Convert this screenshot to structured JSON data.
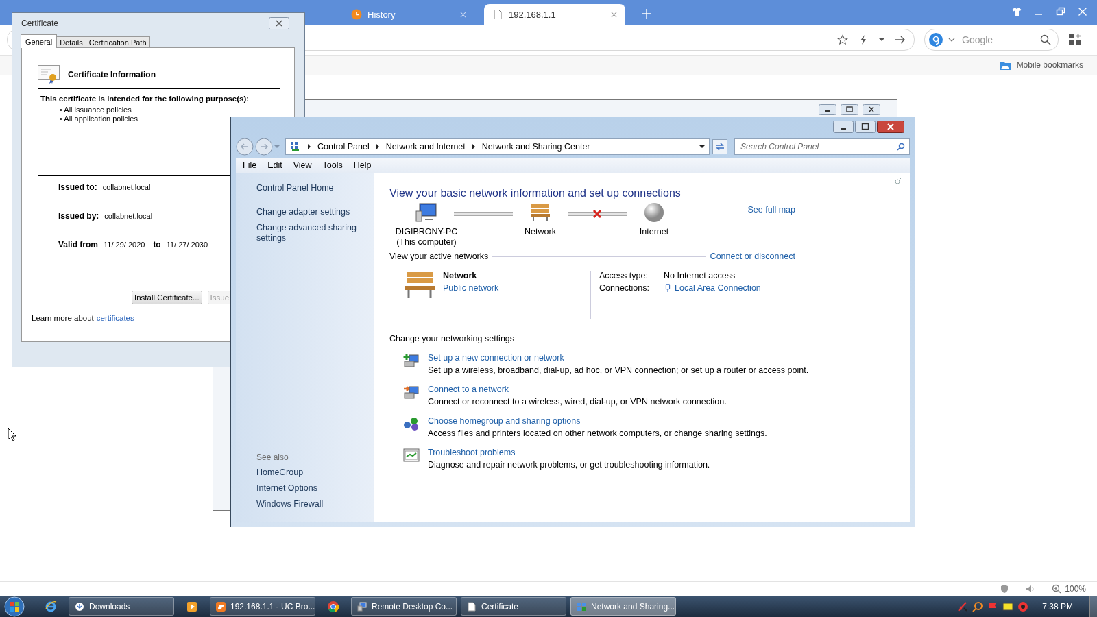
{
  "browser": {
    "tabs": [
      {
        "label": "History",
        "kind": "clock",
        "selected": false
      },
      {
        "label": "192.168.1.1",
        "kind": "page",
        "selected": true
      }
    ],
    "search_placeholder": "Google",
    "bookmark": "Mobile bookmarks",
    "zoom": "100%"
  },
  "certificate_dialog": {
    "title": "Certificate",
    "tabs": [
      {
        "label": "General",
        "selected": true
      },
      {
        "label": "Details",
        "selected": false
      },
      {
        "label": "Certification Path",
        "selected": false
      }
    ],
    "heading": "Certificate Information",
    "purpose_title": "This certificate is intended for the following purpose(s):",
    "purposes": [
      "• All issuance policies",
      "• All application policies"
    ],
    "fields": [
      {
        "label": "Issued to:",
        "value": "collabnet.local"
      },
      {
        "label": "Issued by:",
        "value": "collabnet.local"
      }
    ],
    "valid_from_label": "Valid from",
    "valid_from": "11/ 29/ 2020",
    "valid_to_label": "to",
    "valid_to": "11/ 27/ 2030",
    "buttons": [
      {
        "label": "Install Certificate...",
        "disabled": false
      },
      {
        "label": "Issue",
        "disabled": true
      }
    ],
    "learn_more": "Learn more about",
    "learn_more_link": "certificates"
  },
  "control_panel": {
    "breadcrumb": [
      "Control Panel",
      "Network and Internet",
      "Network and Sharing Center"
    ],
    "search_placeholder": "Search Control Panel",
    "menu": [
      "File",
      "Edit",
      "View",
      "Tools",
      "Help"
    ],
    "side_links": [
      "Control Panel Home",
      "Change adapter settings",
      "Change advanced sharing settings"
    ],
    "see_also_title": "See also",
    "see_also": [
      "HomeGroup",
      "Internet Options",
      "Windows Firewall"
    ],
    "heading": "View your basic network information and set up connections",
    "map": {
      "nodes": [
        {
          "kind": "computer",
          "label": "DIGIBRONY-PC",
          "sublabel": "(This computer)"
        },
        {
          "kind": "network",
          "label": "Network"
        },
        {
          "kind": "internet",
          "label": "Internet"
        }
      ],
      "links": [
        {
          "connected": true
        },
        {
          "connected": false
        }
      ],
      "see_full_map": "See full map"
    },
    "active_title": "View your active networks",
    "connect_link": "Connect or disconnect",
    "network": {
      "name": "Network",
      "type": "Public network",
      "access_label": "Access type:",
      "access": "No Internet access",
      "connections_label": "Connections:",
      "connection": "Local Area Connection"
    },
    "settings_title": "Change your networking settings",
    "tasks": [
      {
        "kind": "new",
        "link": "Set up a new connection or network",
        "description": "Set up a wireless, broadband, dial-up, ad hoc, or VPN connection; or set up a router or access point."
      },
      {
        "kind": "connect",
        "link": "Connect to a network",
        "description": "Connect or reconnect to a wireless, wired, dial-up, or VPN network connection."
      },
      {
        "kind": "homegroup",
        "link": "Choose homegroup and sharing options",
        "description": "Access files and printers located on other network computers, or change sharing settings."
      },
      {
        "kind": "troubleshoot",
        "link": "Troubleshoot problems",
        "description": "Diagnose and repair network problems, or get troubleshooting information."
      }
    ]
  },
  "taskbar": {
    "items": [
      {
        "kind": "ie",
        "selected": false
      },
      {
        "kind": "downloads",
        "label": "Downloads",
        "selected": false
      },
      {
        "kind": "media",
        "selected": false
      },
      {
        "kind": "uc",
        "label": "192.168.1.1 - UC Bro...",
        "selected": false
      },
      {
        "kind": "chrome",
        "selected": false
      },
      {
        "kind": "remote",
        "label": "Remote Desktop Co...",
        "selected": false
      },
      {
        "kind": "document",
        "label": "Certificate",
        "selected": false
      },
      {
        "kind": "network",
        "label": "Network and Sharing...",
        "selected": true
      }
    ],
    "clock": "7:38 PM"
  }
}
